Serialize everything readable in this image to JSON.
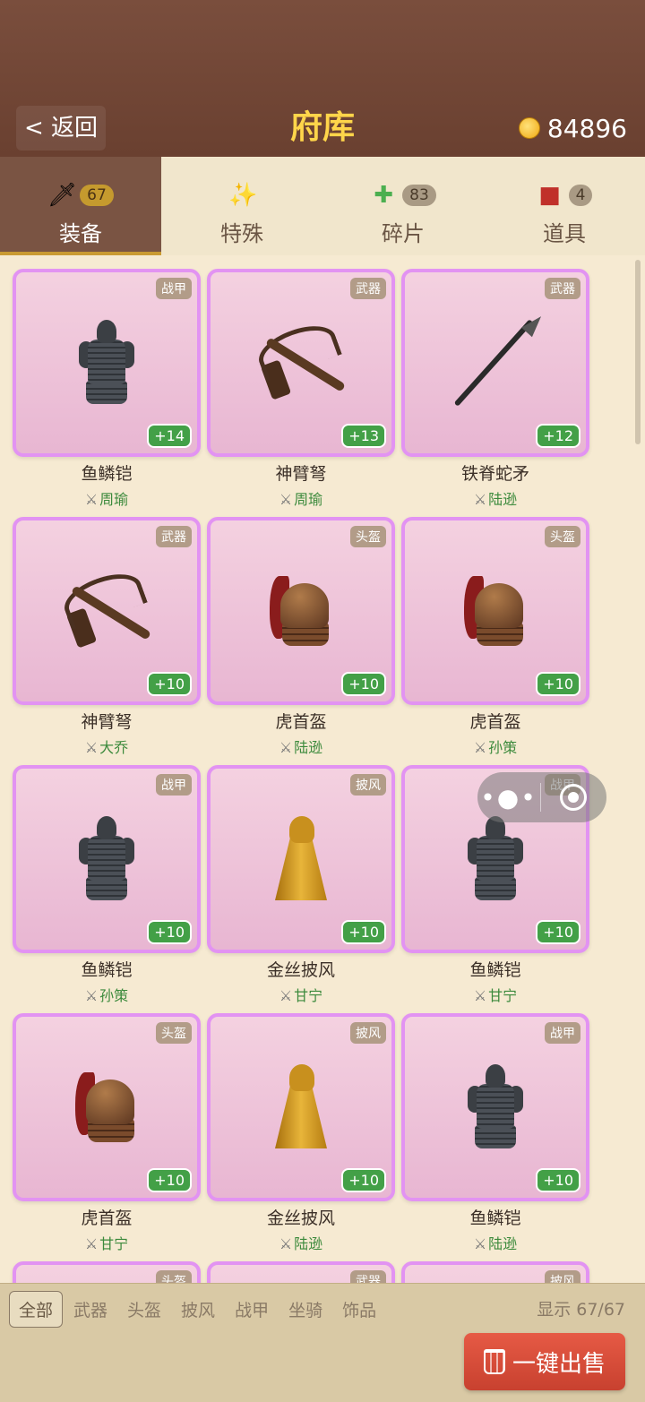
{
  "header": {
    "back_label": "< 返回",
    "title": "府库",
    "coins": "84896"
  },
  "category_tabs": [
    {
      "label": "装备",
      "count": "67",
      "icon": "dagger-icon",
      "active": true
    },
    {
      "label": "特殊",
      "count": "",
      "icon": "sparkle-icon",
      "active": false
    },
    {
      "label": "碎片",
      "count": "83",
      "icon": "puzzle-icon",
      "active": false
    },
    {
      "label": "道具",
      "count": "4",
      "icon": "backpack-icon",
      "active": false
    }
  ],
  "items": [
    {
      "name": "鱼鳞铠",
      "type": "战甲",
      "level": "+14",
      "owner": "周瑜",
      "art": "armor"
    },
    {
      "name": "神臂弩",
      "type": "武器",
      "level": "+13",
      "owner": "周瑜",
      "art": "xbow"
    },
    {
      "name": "铁脊蛇矛",
      "type": "武器",
      "level": "+12",
      "owner": "陆逊",
      "art": "spear"
    },
    {
      "name": "神臂弩",
      "type": "武器",
      "level": "+10",
      "owner": "大乔",
      "art": "xbow"
    },
    {
      "name": "虎首盔",
      "type": "头盔",
      "level": "+10",
      "owner": "陆逊",
      "art": "helmet"
    },
    {
      "name": "虎首盔",
      "type": "头盔",
      "level": "+10",
      "owner": "孙策",
      "art": "helmet"
    },
    {
      "name": "鱼鳞铠",
      "type": "战甲",
      "level": "+10",
      "owner": "孙策",
      "art": "armor"
    },
    {
      "name": "金丝披风",
      "type": "披风",
      "level": "+10",
      "owner": "甘宁",
      "art": "cloak"
    },
    {
      "name": "鱼鳞铠",
      "type": "战甲",
      "level": "+10",
      "owner": "甘宁",
      "art": "armor"
    },
    {
      "name": "虎首盔",
      "type": "头盔",
      "level": "+10",
      "owner": "甘宁",
      "art": "helmet"
    },
    {
      "name": "金丝披风",
      "type": "披风",
      "level": "+10",
      "owner": "陆逊",
      "art": "cloak"
    },
    {
      "name": "鱼鳞铠",
      "type": "战甲",
      "level": "+10",
      "owner": "陆逊",
      "art": "armor"
    },
    {
      "name": "",
      "type": "头盔",
      "level": "",
      "owner": "",
      "art": "none"
    },
    {
      "name": "",
      "type": "武器",
      "level": "",
      "owner": "",
      "art": "none"
    },
    {
      "name": "",
      "type": "披风",
      "level": "",
      "owner": "",
      "art": "none"
    }
  ],
  "filters": [
    "全部",
    "武器",
    "头盔",
    "披风",
    "战甲",
    "坐骑",
    "饰品"
  ],
  "active_filter": "全部",
  "display_count": "显示 67/67",
  "sell_button": "一键出售"
}
